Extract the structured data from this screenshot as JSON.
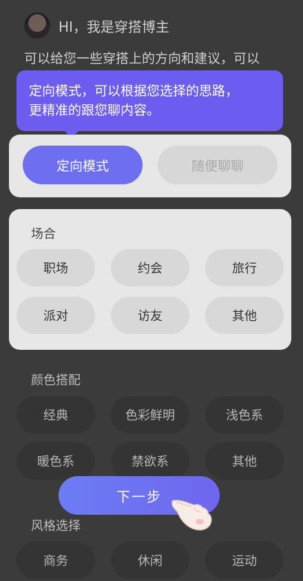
{
  "header": {
    "greeting": "HI，我是穿搭博主"
  },
  "intro_text": "可以给您一些穿搭上的方向和建议，可以",
  "tooltip": {
    "line1": "定向模式，可以根据您选择的思路，",
    "line2": "更精准的跟您聊内容。"
  },
  "modes": {
    "primary": "定向模式",
    "secondary": "随便聊聊"
  },
  "occasion": {
    "title": "场合",
    "options": [
      "职场",
      "约会",
      "旅行",
      "派对",
      "访友",
      "其他"
    ]
  },
  "color": {
    "title": "颜色搭配",
    "options": [
      "经典",
      "色彩鲜明",
      "浅色系",
      "暖色系",
      "禁欲系",
      "其他"
    ]
  },
  "style": {
    "title": "风格选择",
    "options": [
      "商务",
      "休闲",
      "运动"
    ]
  },
  "next_button": "下一步",
  "colors": {
    "accent": "#6c5cf0",
    "button": "#6d6ff0",
    "card": "#e7e7e7",
    "overlay": "#3b3b3b"
  }
}
